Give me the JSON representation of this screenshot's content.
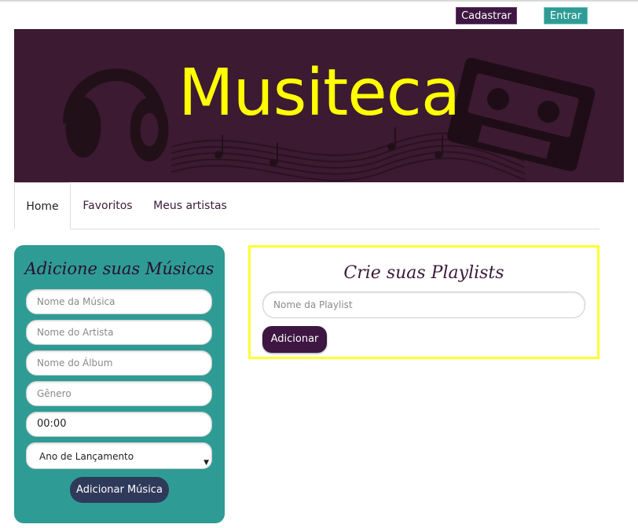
{
  "header": {
    "register_label": "Cadastrar",
    "login_label": "Entrar"
  },
  "banner": {
    "brand": "Musiteca"
  },
  "nav": {
    "tabs": [
      {
        "label": "Home",
        "active": true
      },
      {
        "label": "Favoritos",
        "active": false
      },
      {
        "label": "Meus artistas",
        "active": false
      }
    ]
  },
  "music_form": {
    "title": "Adicione suas Músicas",
    "song_placeholder": "Nome da Música",
    "artist_placeholder": "Nome do Artista",
    "album_placeholder": "Nome do Álbum",
    "genre_placeholder": "Gênero",
    "duration_value": "00:00",
    "year_select_value": "Ano de Lançamento",
    "submit_label": "Adicionar Música"
  },
  "playlist_form": {
    "title": "Crie suas Playlists",
    "name_placeholder": "Nome da Playlist",
    "submit_label": "Adicionar"
  },
  "colors": {
    "brand_purple": "#3d1642",
    "teal": "#2e9c95",
    "brand_yellow": "#ffff00",
    "highlight_border": "#ffff33"
  }
}
